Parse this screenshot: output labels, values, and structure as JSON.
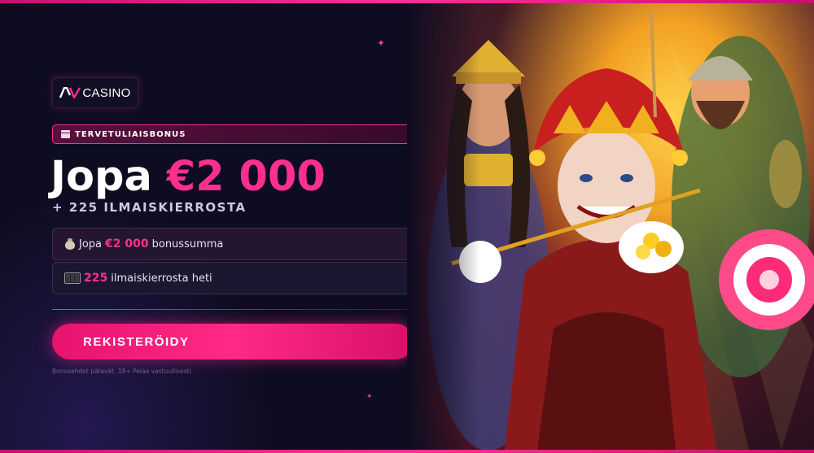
{
  "brand": {
    "logo_text": "CASINO",
    "accent": "#ff2f8f"
  },
  "bonus": {
    "tag_label": "TERVETULIAISBONUS",
    "headline_prefix": "Jopa",
    "headline_amount": "€2 000",
    "subhead": "+ 225 ILMAISKIERROSTA"
  },
  "features": [
    {
      "icon": "money-bag-icon",
      "prefix": "Jopa",
      "highlight": "€2 000",
      "text": "bonussumma"
    },
    {
      "icon": "slot-reels-icon",
      "prefix": "",
      "highlight": "225",
      "text": "ilmaiskierrosta heti"
    }
  ],
  "cta": {
    "label": "REKISTERÖIDY"
  },
  "disclaimer": "Bonusehdot pätevät. 18+ Pelaa vastuullisesti.",
  "hero": {
    "image": "slot-characters-illustration"
  }
}
